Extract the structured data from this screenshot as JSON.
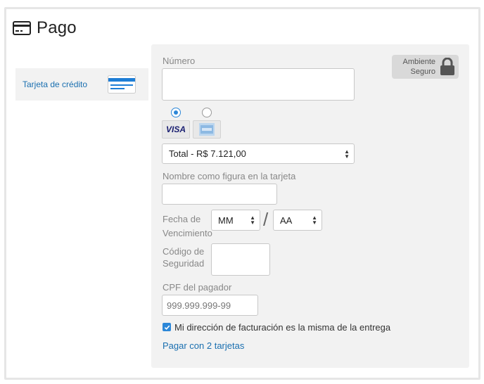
{
  "header": {
    "title": "Pago",
    "icon": "credit-card-icon"
  },
  "payment_methods": [
    {
      "label": "Tarjeta de crédito",
      "icon": "credit-card-icon",
      "selected": true
    }
  ],
  "secure_badge": {
    "line1": "Ambiente",
    "line2": "Seguro",
    "icon": "lock-icon"
  },
  "form": {
    "number_label": "Número",
    "number_value": "",
    "brands": [
      {
        "name": "VISA",
        "selected": true
      },
      {
        "name": "amex-icon",
        "selected": false
      }
    ],
    "installments_selected": "Total - R$ 7.121,00",
    "name_label": "Nombre como figura en la tarjeta",
    "name_value": "",
    "expiry_label_line1": "Fecha de",
    "expiry_label_line2": "Vencimiento",
    "expiry_month": "MM",
    "expiry_year": "AA",
    "expiry_separator": "/",
    "cvv_label_line1": "Código de",
    "cvv_label_line2": "Seguridad",
    "cvv_value": "",
    "cpf_label": "CPF del pagador",
    "cpf_placeholder": "999.999.999-99",
    "billing_same_checked": true,
    "billing_same_label": "Mi dirección de facturación es la misma de la entrega",
    "two_cards_link": "Pagar con 2 tarjetas"
  },
  "colors": {
    "accent": "#2c87d8",
    "link": "#1a6fb0",
    "panel_bg": "#f2f2f2",
    "badge_bg": "#d9d9d9"
  }
}
